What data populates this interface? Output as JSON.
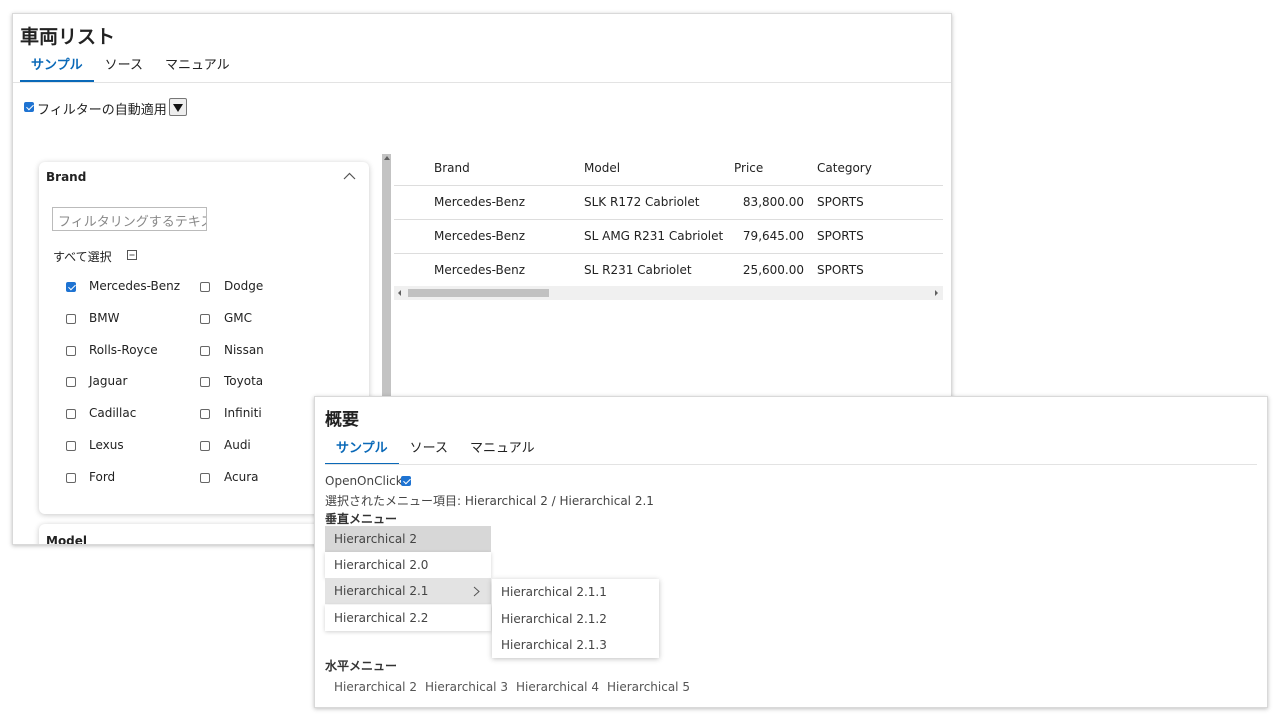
{
  "panel1": {
    "title": "車両リスト",
    "tabs": [
      "サンプル",
      "ソース",
      "マニュアル"
    ],
    "auto_filter_label": "フィルターの自動適用",
    "auto_filter_checked": true,
    "brand_card": {
      "title": "Brand",
      "filter_placeholder": "フィルタリングするテキスト",
      "select_all_label": "すべて選択",
      "brands_left": [
        {
          "label": "Mercedes-Benz",
          "checked": true
        },
        {
          "label": "BMW",
          "checked": false
        },
        {
          "label": "Rolls-Royce",
          "checked": false
        },
        {
          "label": "Jaguar",
          "checked": false
        },
        {
          "label": "Cadillac",
          "checked": false
        },
        {
          "label": "Lexus",
          "checked": false
        },
        {
          "label": "Ford",
          "checked": false
        }
      ],
      "brands_right": [
        {
          "label": "Dodge",
          "checked": false
        },
        {
          "label": "GMC",
          "checked": false
        },
        {
          "label": "Nissan",
          "checked": false
        },
        {
          "label": "Toyota",
          "checked": false
        },
        {
          "label": "Infiniti",
          "checked": false
        },
        {
          "label": "Audi",
          "checked": false
        },
        {
          "label": "Acura",
          "checked": false
        }
      ]
    },
    "model_card_title": "Model",
    "grid": {
      "headers": [
        "Brand",
        "Model",
        "Price",
        "Category"
      ],
      "rows": [
        [
          "Mercedes-Benz",
          "SLK R172 Cabriolet",
          "83,800.00",
          "SPORTS"
        ],
        [
          "Mercedes-Benz",
          "SL AMG R231 Cabriolet",
          "79,645.00",
          "SPORTS"
        ],
        [
          "Mercedes-Benz",
          "SL R231 Cabriolet",
          "25,600.00",
          "SPORTS"
        ]
      ]
    }
  },
  "panel2": {
    "title": "概要",
    "tabs": [
      "サンプル",
      "ソース",
      "マニュアル"
    ],
    "open_on_click_label": "OpenOnClick",
    "open_on_click_checked": true,
    "selected_text": "選択されたメニュー項目: Hierarchical 2 / Hierarchical 2.1",
    "vertical_menu_title": "垂直メニュー",
    "vertical_items": [
      "Hierarchical 2",
      "Hierarchical 2.0",
      "Hierarchical 2.1",
      "Hierarchical 2.2"
    ],
    "submenu_items": [
      "Hierarchical 2.1.1",
      "Hierarchical 2.1.2",
      "Hierarchical 2.1.3"
    ],
    "horizontal_menu_title": "水平メニュー",
    "horizontal_items": [
      "Hierarchical 2",
      "Hierarchical 3",
      "Hierarchical 4",
      "Hierarchical 5"
    ]
  },
  "colors": {
    "accent": "#0a69b8",
    "checkbox": "#1e73d2",
    "selected_item": "#d7d7d7"
  }
}
